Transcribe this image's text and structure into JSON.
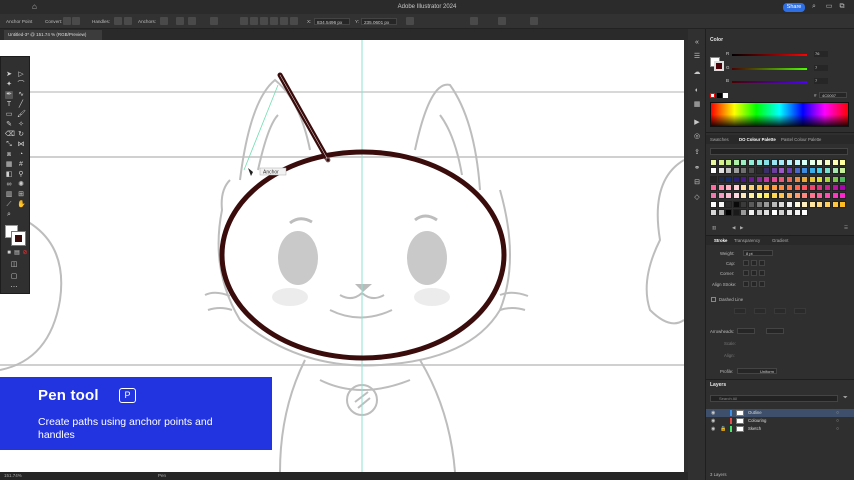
{
  "app": {
    "title": "Adobe Illustrator 2024",
    "share_label": "Share"
  },
  "controlbar": {
    "tool_label": "Anchor Point",
    "convert_label": "Convert:",
    "handles_label": "Handles:",
    "anchors_label": "Anchors:",
    "x_value": "834.5496 px",
    "y_value": "235.0601 px"
  },
  "document": {
    "tab_title": "Untitled-3* @ 151.74 % (RGB/Preview)",
    "zoom_status": "151.74%",
    "tool_status": "Pen"
  },
  "canvas": {
    "cursor_label": "Anchor"
  },
  "color_panel": {
    "title": "Color",
    "r_value": "76",
    "g_value": "7",
    "b_value": "7",
    "hex_value": "4C0007",
    "tabs": [
      "Swatches",
      "DO Colour Palette",
      "Pastel Colour Palette"
    ],
    "active_tab": "DO Colour Palette"
  },
  "stroke_panel": {
    "tabs": [
      "Stroke",
      "Transparency",
      "Gradient"
    ],
    "weight_label": "Weight:",
    "weight_value": "8 pt",
    "cap_label": "Cap:",
    "corner_label": "Corner:",
    "align_label": "Align Stroke:",
    "dashed_label": "Dashed Line",
    "arrowheads_label": "Arrowheads:",
    "scale_label": "Scale:",
    "align2_label": "Align:",
    "profile_label": "Profile:",
    "profile_value": "Uniform"
  },
  "layers_panel": {
    "title": "Layers",
    "search_placeholder": "Search All",
    "layers": [
      {
        "name": "Outline",
        "color": "#3e8ee8",
        "selected": true
      },
      {
        "name": "Colouring",
        "color": "#e84a4a",
        "selected": false
      },
      {
        "name": "Sketch",
        "color": "#4ae86a",
        "selected": false
      }
    ],
    "count_label": "3 Layers"
  },
  "banner": {
    "title": "Pen tool",
    "shortcut": "P",
    "description": "Create paths using anchor points and handles"
  },
  "colors": {
    "stroke": "#3a0c0c",
    "banner_bg": "#2233e0",
    "guide": "#7fdcc7"
  }
}
